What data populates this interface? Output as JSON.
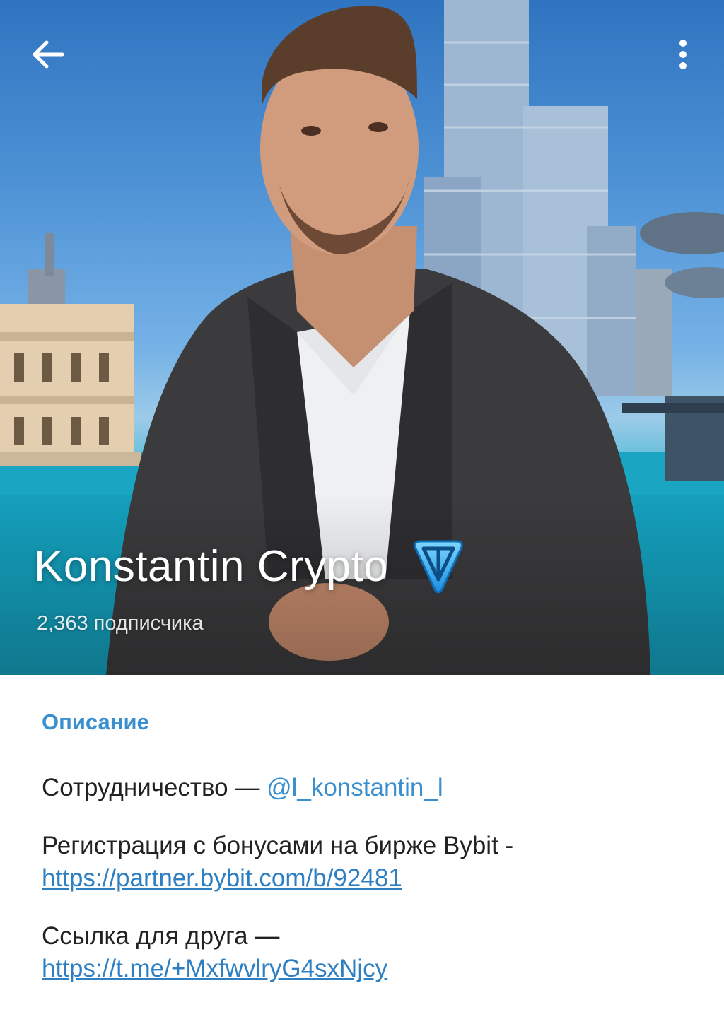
{
  "header": {
    "back_icon": "arrow-left-icon",
    "menu_icon": "more-vertical-icon",
    "title": "Konstantin Crypto",
    "badge_icon": "ton-diamond-icon",
    "subscribers": "2,363 подписчика"
  },
  "description": {
    "label": "Описание",
    "cooperation_text": "Сотрудничество — ",
    "cooperation_handle": "@l_konstantin_l",
    "registration_text": "Регистрация с бонусами на бирже Bybit -",
    "registration_link": "https://partner.bybit.com/b/92481",
    "friend_text": "Ссылка для друга —",
    "friend_link": "https://t.me/+MxfwvlryG4sxNjcy"
  },
  "colors": {
    "accent": "#3a8fcf",
    "link": "#2e7fc2",
    "text": "#222222"
  }
}
